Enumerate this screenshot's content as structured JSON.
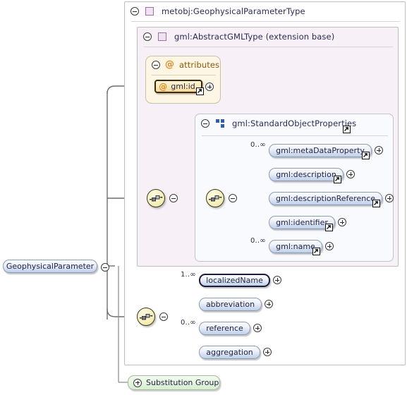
{
  "diagram": {
    "title": "metobj:GeophysicalParameterType",
    "root_element": "GeophysicalParameter",
    "substitution_group_label": "Substitution Group",
    "accent_type_color": "#a46aa8",
    "accent_group_color": "#2f5fa8",
    "accent_attribute_color": "#e08a20",
    "node_fill_color": "#c8d6ec",
    "substitution_fill_color": "#d6eece",
    "attribute_fill_color": "#f4d79a",
    "compositor_fill_color": "#f6f0bc"
  },
  "boxes": {
    "outer": {
      "label": "metobj:GeophysicalParameterType",
      "icon": "type-square-icon",
      "toggle": "collapse-icon"
    },
    "extension_base": {
      "label": "gml:AbstractGMLType (extension base)",
      "icon": "type-square-icon",
      "toggle": "collapse-icon"
    },
    "attributes": {
      "label": "attributes",
      "icon": "attribute-at-icon",
      "toggle": "collapse-icon"
    },
    "standard_object_properties": {
      "label": "gml:StandardObjectProperties",
      "icon": "group-squares-icon",
      "toggle": "collapse-icon",
      "has_reference": true
    }
  },
  "nodes": {
    "gml_id": {
      "label": "gml:id",
      "icon": "attribute-at-icon",
      "expand": "expand-icon",
      "has_reference": true,
      "required": true
    },
    "root": {
      "label": "GeophysicalParameter",
      "toggle": "collapse-icon"
    },
    "substitution_group": {
      "label": "Substitution Group",
      "expand": "expand-icon"
    }
  },
  "sequences": {
    "base_sequence": {
      "name": "sequence-compositor",
      "toggle": "collapse-icon"
    },
    "standard_props_sequence": {
      "name": "sequence-compositor",
      "toggle": "collapse-icon"
    },
    "local_sequence": {
      "name": "sequence-compositor",
      "toggle": "collapse-icon"
    }
  },
  "standard_object_properties_children": [
    {
      "label": "gml:metaDataProperty",
      "cardinality": "0..∞",
      "required": false,
      "has_reference": true,
      "expand": "expand-icon"
    },
    {
      "label": "gml:description",
      "cardinality": "",
      "required": false,
      "has_reference": true,
      "expand": "expand-icon"
    },
    {
      "label": "gml:descriptionReference",
      "cardinality": "",
      "required": false,
      "has_reference": true,
      "expand": "expand-icon"
    },
    {
      "label": "gml:identifier",
      "cardinality": "",
      "required": false,
      "has_reference": true,
      "expand": "expand-icon"
    },
    {
      "label": "gml:name",
      "cardinality": "0..∞",
      "required": false,
      "has_reference": true,
      "expand": "expand-icon"
    }
  ],
  "local_children": [
    {
      "label": "localizedName",
      "cardinality": "1..∞",
      "required": true,
      "has_reference": false,
      "expand": "expand-icon"
    },
    {
      "label": "abbreviation",
      "cardinality": "",
      "required": false,
      "has_reference": false,
      "expand": "expand-icon"
    },
    {
      "label": "reference",
      "cardinality": "0..∞",
      "required": false,
      "has_reference": false,
      "expand": "expand-icon"
    },
    {
      "label": "aggregation",
      "cardinality": "",
      "required": false,
      "has_reference": false,
      "expand": "expand-icon"
    }
  ]
}
